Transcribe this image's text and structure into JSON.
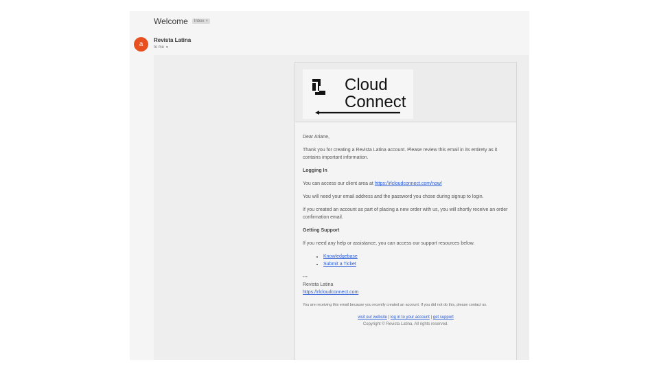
{
  "subject": "Welcome",
  "label_chip": "Inbox",
  "label_remove": "×",
  "sender": {
    "avatar_letter": "a",
    "name": "Revista Latina",
    "to": "to me",
    "details_caret": "▾"
  },
  "logo": {
    "line1": "Cloud",
    "line2": "Connect"
  },
  "email": {
    "greeting": "Dear Ariane,",
    "intro": "Thank you for creating a Revista Latina account. Please review this email in its entirety as it contains important information.",
    "logging_in_title": "Logging In",
    "client_area_prefix": "You can access our client area at ",
    "client_area_link": "https://rlcloudconnect.com/now/",
    "password_note": "You will need your email address and the password you chose during signup to login.",
    "order_note": "If you created an account as part of placing a new order with us, you will shortly receive an order confirmation email.",
    "support_title": "Getting Support",
    "support_intro": "If you need any help or assistance, you can access our support resources below.",
    "support_links": [
      "Knowledgebase",
      "Submit a Ticket"
    ],
    "signoff_dashes": "---",
    "signoff_name": "Revista Latina",
    "signoff_url": "https://rlcloudconnect.com",
    "fineprint": "You are receiving this email because you recently created an account. If you did not do this, please contact us.",
    "footer_links": [
      "visit our website",
      "log in to your account",
      "get support"
    ],
    "footer_separator": "|",
    "copyright": "Copyright © Revista Latina, All rights reserved."
  },
  "colors": {
    "avatar": "#e8501f",
    "link": "#2a5bd7"
  }
}
